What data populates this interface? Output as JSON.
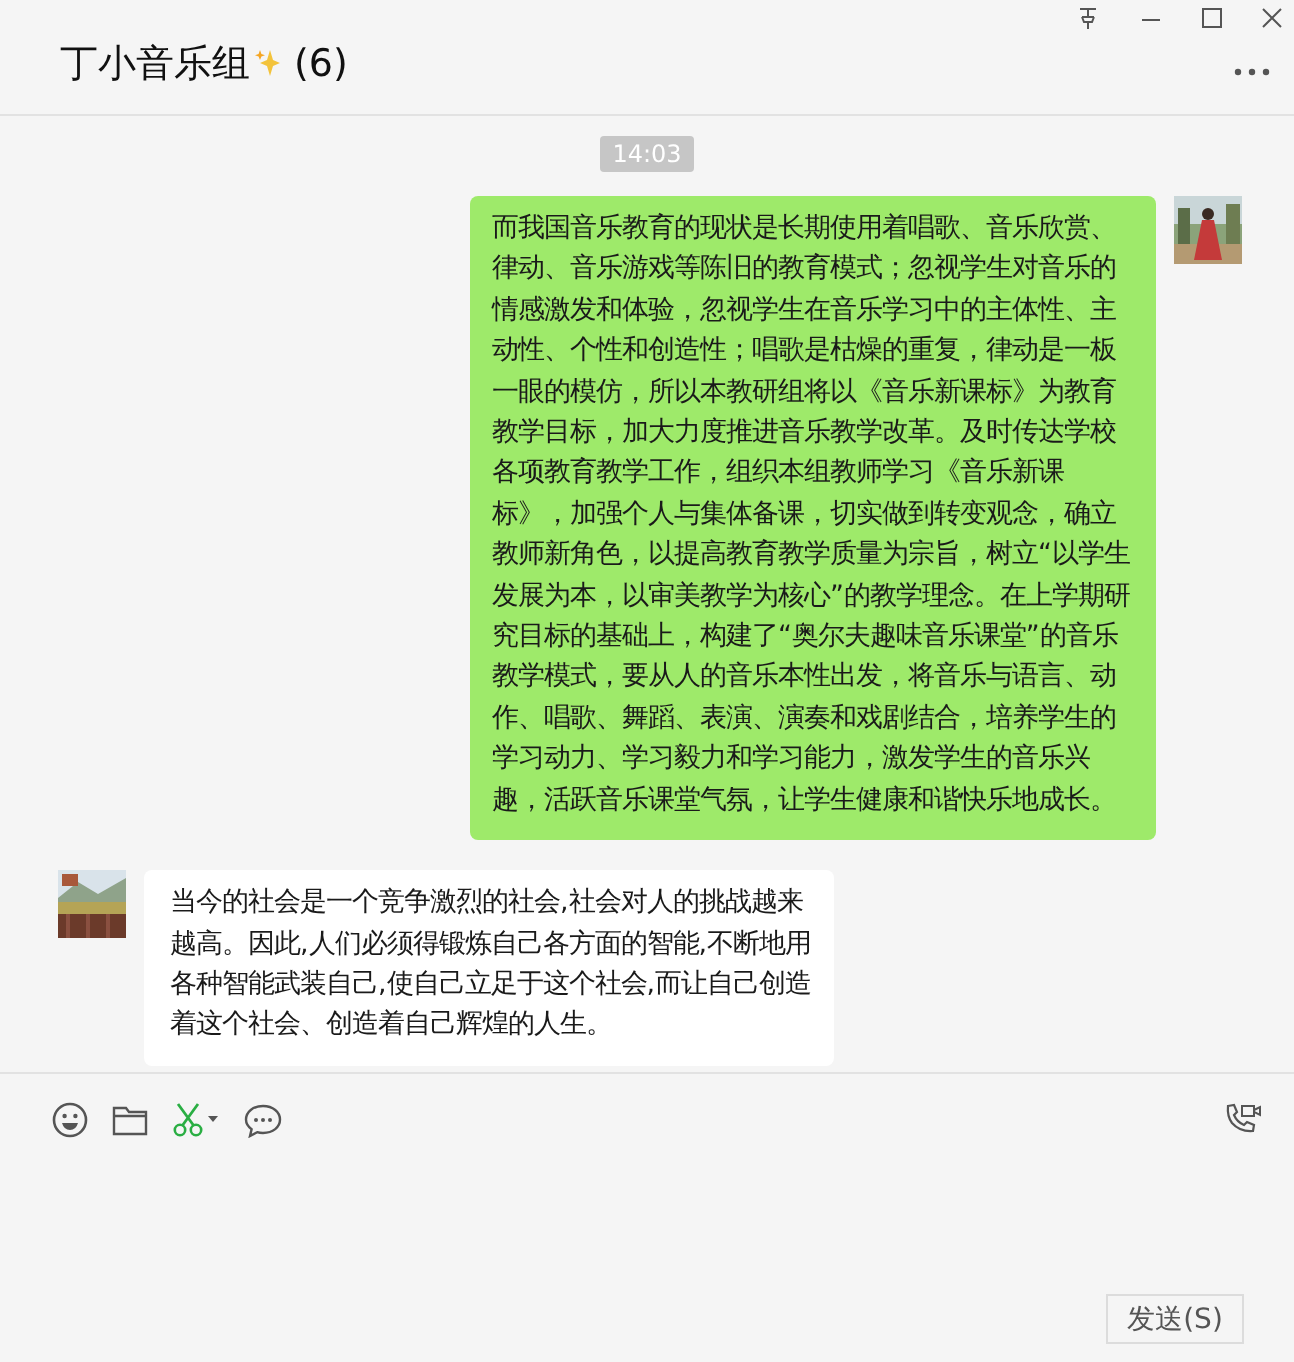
{
  "window": {
    "title": "丁小音乐组",
    "count": "(6)"
  },
  "timestamp": "14:03",
  "messages": [
    {
      "kind": "sent",
      "text": "而我国音乐教育的现状是长期使用着唱歌、音乐欣赏、律动、音乐游戏等陈旧的教育模式；忽视学生对音乐的情感激发和体验，忽视学生在音乐学习中的主体性、主动性、个性和创造性；唱歌是枯燥的重复，律动是一板一眼的模仿，所以本教研组将以《音乐新课标》为教育教学目标，加大力度推进音乐教学改革。及时传达学校各项教育教学工作，组织本组教师学习《音乐新课标》，加强个人与集体备课，切实做到转变观念，确立教师新角色，以提高教育教学质量为宗旨，树立“以学生发展为本，以审美教学为核心”的教学理念。在上学期研究目标的基础上，构建了“奥尔夫趣味音乐课堂”的音乐教学模式，要从人的音乐本性出发，将音乐与语言、动作、唱歌、舞蹈、表演、演奏和戏剧结合，培养学生的学习动力、学习毅力和学习能力，激发学生的音乐兴趣，活跃音乐课堂气氛，让学生健康和谐快乐地成长。"
    },
    {
      "kind": "received",
      "text": " 当今的社会是一个竞争激烈的社会,社会对人的挑战越来越高。因此,人们必须得锻炼自己各方面的智能,不断地用各种智能武装自己,使自己立足于这个社会,而让自己创造着这个社会、创造着自己辉煌的人生。"
    }
  ],
  "send_button": "发送(S)"
}
